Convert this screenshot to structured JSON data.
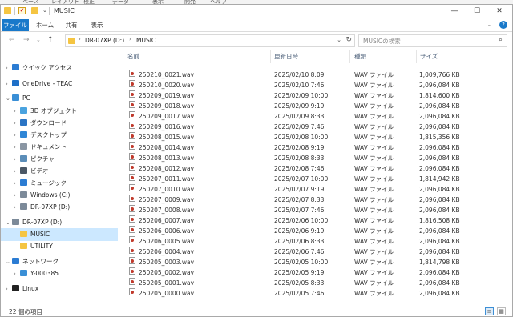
{
  "window": {
    "title": "MUSIC",
    "controls": {
      "minimize": "—",
      "maximize": "☐",
      "close": "✕"
    }
  },
  "ribbon": {
    "tabs": [
      "ファイル",
      "ホーム",
      "共有",
      "表示"
    ]
  },
  "address": {
    "crumbs": [
      "DR-07XP (D:)",
      "MUSIC"
    ],
    "search_placeholder": "MUSICの検索"
  },
  "sidebar": {
    "items": [
      {
        "label": "クイック アクセス",
        "icon": "star-icon",
        "color": "#2b7cd3",
        "depth": 0,
        "arrow": "›"
      },
      {
        "label": "OneDrive - TEAC",
        "icon": "cloud-icon",
        "color": "#1e6fc7",
        "depth": 0,
        "arrow": "›"
      },
      {
        "label": "PC",
        "icon": "computer-icon",
        "color": "#3a8fd6",
        "depth": 0,
        "arrow": "⌄"
      },
      {
        "label": "3D オブジェクト",
        "icon": "cube-icon",
        "color": "#4aa3df",
        "depth": 1,
        "arrow": "›"
      },
      {
        "label": "ダウンロード",
        "icon": "download-icon",
        "color": "#2a74c4",
        "depth": 1,
        "arrow": "›"
      },
      {
        "label": "デスクトップ",
        "icon": "desktop-icon",
        "color": "#2f86d6",
        "depth": 1,
        "arrow": "›"
      },
      {
        "label": "ドキュメント",
        "icon": "documents-icon",
        "color": "#8a96a3",
        "depth": 1,
        "arrow": "›"
      },
      {
        "label": "ピクチャ",
        "icon": "pictures-icon",
        "color": "#5b8db8",
        "depth": 1,
        "arrow": "›"
      },
      {
        "label": "ビデオ",
        "icon": "video-icon",
        "color": "#4b5866",
        "depth": 1,
        "arrow": "›"
      },
      {
        "label": "ミュージック",
        "icon": "music-icon",
        "color": "#2b7cd3",
        "depth": 1,
        "arrow": "›"
      },
      {
        "label": "Windows (C:)",
        "icon": "drive-icon",
        "color": "#7c8a99",
        "depth": 1,
        "arrow": "›"
      },
      {
        "label": "DR-07XP (D:)",
        "icon": "drive-icon",
        "color": "#7c8a99",
        "depth": 1,
        "arrow": "›"
      },
      {
        "label": "DR-07XP (D:)",
        "icon": "drive-icon",
        "color": "#7c8a99",
        "depth": 0,
        "arrow": "⌄"
      },
      {
        "label": "MUSIC",
        "icon": "folder-icon",
        "color": "#f5c542",
        "depth": 1,
        "arrow": "",
        "selected": true
      },
      {
        "label": "UTILITY",
        "icon": "folder-icon",
        "color": "#f5c542",
        "depth": 1,
        "arrow": ""
      },
      {
        "label": "ネットワーク",
        "icon": "network-icon",
        "color": "#2b7cd3",
        "depth": 0,
        "arrow": "⌄"
      },
      {
        "label": "Y-000385",
        "icon": "computer-icon",
        "color": "#3a8fd6",
        "depth": 1,
        "arrow": "›"
      },
      {
        "label": "Linux",
        "icon": "linux-icon",
        "color": "#222222",
        "depth": 0,
        "arrow": "›"
      }
    ]
  },
  "columns": [
    "名前",
    "更新日時",
    "種類",
    "サイズ"
  ],
  "files": [
    {
      "name": "250210_0021.wav",
      "date": "2025/02/10 8:09",
      "type": "WAV ファイル",
      "size": "1,009,766 KB"
    },
    {
      "name": "250210_0020.wav",
      "date": "2025/02/10 7:46",
      "type": "WAV ファイル",
      "size": "2,096,084 KB"
    },
    {
      "name": "250209_0019.wav",
      "date": "2025/02/09 10:00",
      "type": "WAV ファイル",
      "size": "1,814,600 KB"
    },
    {
      "name": "250209_0018.wav",
      "date": "2025/02/09 9:19",
      "type": "WAV ファイル",
      "size": "2,096,084 KB"
    },
    {
      "name": "250209_0017.wav",
      "date": "2025/02/09 8:33",
      "type": "WAV ファイル",
      "size": "2,096,084 KB"
    },
    {
      "name": "250209_0016.wav",
      "date": "2025/02/09 7:46",
      "type": "WAV ファイル",
      "size": "2,096,084 KB"
    },
    {
      "name": "250208_0015.wav",
      "date": "2025/02/08 10:00",
      "type": "WAV ファイル",
      "size": "1,815,356 KB"
    },
    {
      "name": "250208_0014.wav",
      "date": "2025/02/08 9:19",
      "type": "WAV ファイル",
      "size": "2,096,084 KB"
    },
    {
      "name": "250208_0013.wav",
      "date": "2025/02/08 8:33",
      "type": "WAV ファイル",
      "size": "2,096,084 KB"
    },
    {
      "name": "250208_0012.wav",
      "date": "2025/02/08 7:46",
      "type": "WAV ファイル",
      "size": "2,096,084 KB"
    },
    {
      "name": "250207_0011.wav",
      "date": "2025/02/07 10:00",
      "type": "WAV ファイル",
      "size": "1,814,942 KB"
    },
    {
      "name": "250207_0010.wav",
      "date": "2025/02/07 9:19",
      "type": "WAV ファイル",
      "size": "2,096,084 KB"
    },
    {
      "name": "250207_0009.wav",
      "date": "2025/02/07 8:33",
      "type": "WAV ファイル",
      "size": "2,096,084 KB"
    },
    {
      "name": "250207_0008.wav",
      "date": "2025/02/07 7:46",
      "type": "WAV ファイル",
      "size": "2,096,084 KB"
    },
    {
      "name": "250206_0007.wav",
      "date": "2025/02/06 10:00",
      "type": "WAV ファイル",
      "size": "1,816,508 KB"
    },
    {
      "name": "250206_0006.wav",
      "date": "2025/02/06 9:19",
      "type": "WAV ファイル",
      "size": "2,096,084 KB"
    },
    {
      "name": "250206_0005.wav",
      "date": "2025/02/06 8:33",
      "type": "WAV ファイル",
      "size": "2,096,084 KB"
    },
    {
      "name": "250206_0004.wav",
      "date": "2025/02/06 7:46",
      "type": "WAV ファイル",
      "size": "2,096,084 KB"
    },
    {
      "name": "250205_0003.wav",
      "date": "2025/02/05 10:00",
      "type": "WAV ファイル",
      "size": "1,814,798 KB"
    },
    {
      "name": "250205_0002.wav",
      "date": "2025/02/05 9:19",
      "type": "WAV ファイル",
      "size": "2,096,084 KB"
    },
    {
      "name": "250205_0001.wav",
      "date": "2025/02/05 8:33",
      "type": "WAV ファイル",
      "size": "2,096,084 KB"
    },
    {
      "name": "250205_0000.wav",
      "date": "2025/02/05 7:46",
      "type": "WAV ファイル",
      "size": "2,096,084 KB"
    }
  ],
  "status": {
    "count_text": "22 個の項目"
  },
  "colors": {
    "accent": "#1979ca",
    "selection": "#cce8ff",
    "header_text": "#4c607a"
  }
}
